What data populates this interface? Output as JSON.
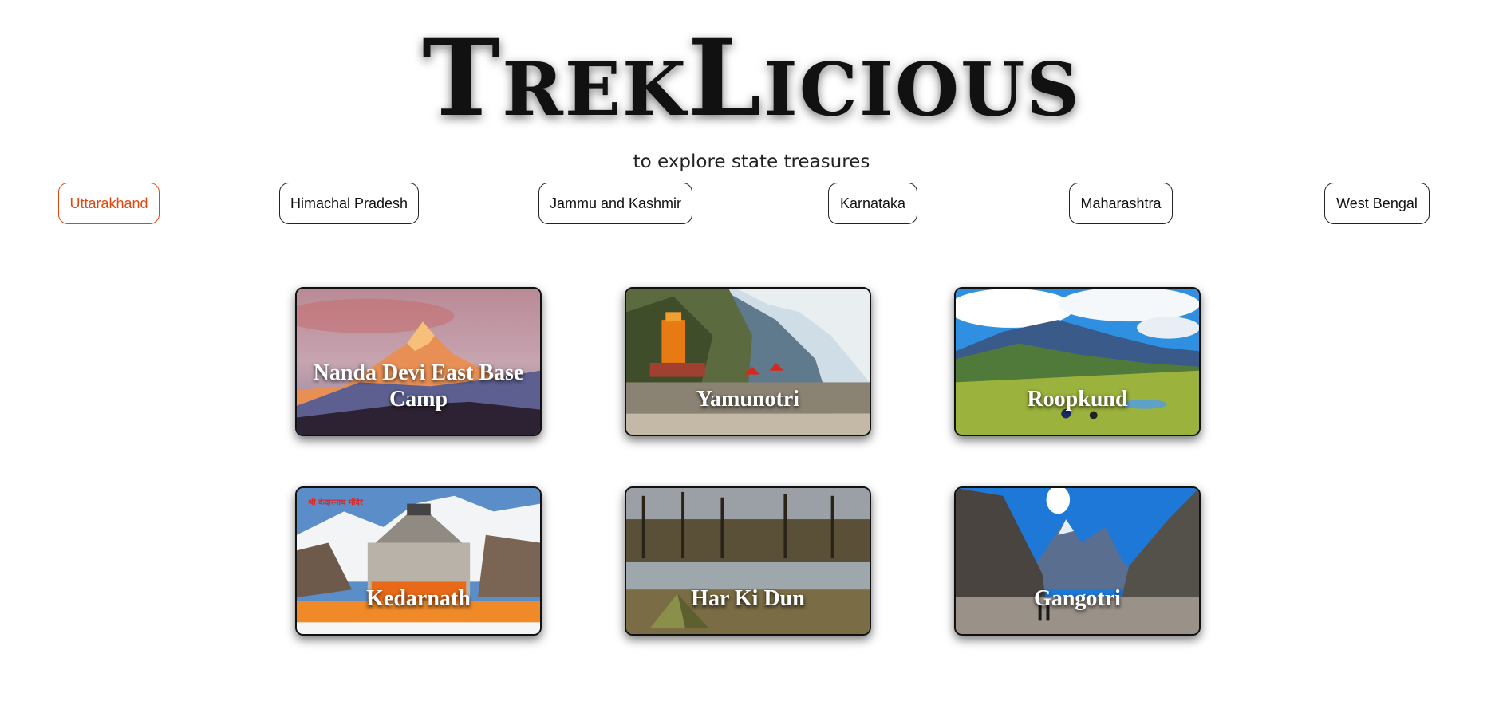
{
  "header": {
    "brand": "TrekLicious",
    "tagline": "to explore state treasures"
  },
  "states": [
    {
      "label": "Uttarakhand",
      "active": true
    },
    {
      "label": "Himachal Pradesh",
      "active": false
    },
    {
      "label": "Jammu and Kashmir",
      "active": false
    },
    {
      "label": "Karnataka",
      "active": false
    },
    {
      "label": "Maharashtra",
      "active": false
    },
    {
      "label": "West Bengal",
      "active": false
    }
  ],
  "treks": [
    {
      "name": "Nanda Devi East Base Camp"
    },
    {
      "name": "Yamunotri"
    },
    {
      "name": "Roopkund"
    },
    {
      "name": "Kedarnath",
      "badge": "श्री केदारनाथ मंदिर"
    },
    {
      "name": "Har Ki Dun"
    },
    {
      "name": "Gangotri"
    }
  ],
  "colors": {
    "accent": "#e0470e"
  }
}
